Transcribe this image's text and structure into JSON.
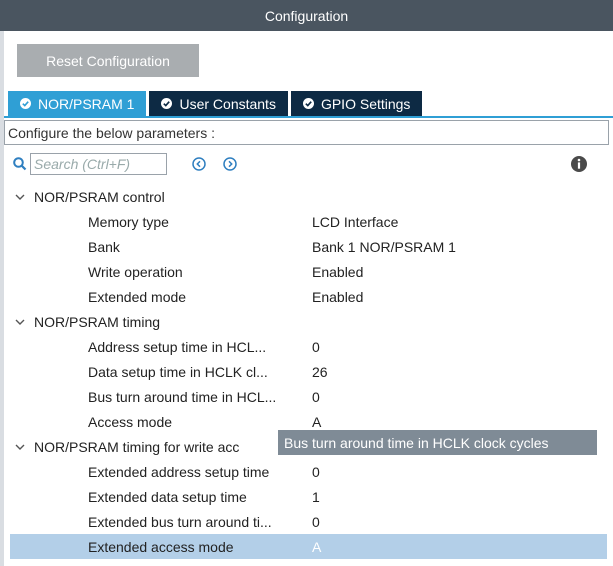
{
  "window": {
    "title": "Configuration"
  },
  "toolbar": {
    "reset_label": "Reset Configuration"
  },
  "tabs": [
    {
      "label": "NOR/PSRAM 1",
      "active": true
    },
    {
      "label": "User Constants",
      "active": false
    },
    {
      "label": "GPIO Settings",
      "active": false
    }
  ],
  "params_label": "Configure the below parameters :",
  "search": {
    "placeholder": "Search (Ctrl+F)"
  },
  "icons": {
    "search": "search-icon",
    "prev": "chevron-left-circle-icon",
    "next": "chevron-right-circle-icon",
    "info": "info-icon"
  },
  "tree": {
    "groups": [
      {
        "label": "NOR/PSRAM control",
        "items": [
          {
            "label": "Memory type",
            "value": "LCD Interface"
          },
          {
            "label": "Bank",
            "value": "Bank 1 NOR/PSRAM 1"
          },
          {
            "label": "Write operation",
            "value": "Enabled"
          },
          {
            "label": "Extended mode",
            "value": "Enabled"
          }
        ]
      },
      {
        "label": "NOR/PSRAM timing",
        "items": [
          {
            "label": "Address setup time in HCL...",
            "value": "0"
          },
          {
            "label": "Data setup time in HCLK cl...",
            "value": "26"
          },
          {
            "label": "Bus turn around time in HCL...",
            "value": "0"
          },
          {
            "label": "Access mode",
            "value": "A"
          }
        ]
      },
      {
        "label": "NOR/PSRAM timing for write acc",
        "items": [
          {
            "label": "Extended address setup time",
            "value": "0"
          },
          {
            "label": "Extended data setup time",
            "value": "1"
          },
          {
            "label": "Extended bus turn around ti...",
            "value": "0"
          },
          {
            "label": "Extended access mode",
            "value": "A"
          }
        ]
      }
    ]
  },
  "tooltip": "Bus turn around time in HCLK clock cycles",
  "colors": {
    "titlebar": "#4a5560",
    "tab_active": "#2f9fd5",
    "tab_inactive": "#0d2a44",
    "accent": "#2f9fd5",
    "selected_row": "#b3cfe8",
    "tooltip_bg": "#7f8b96"
  }
}
